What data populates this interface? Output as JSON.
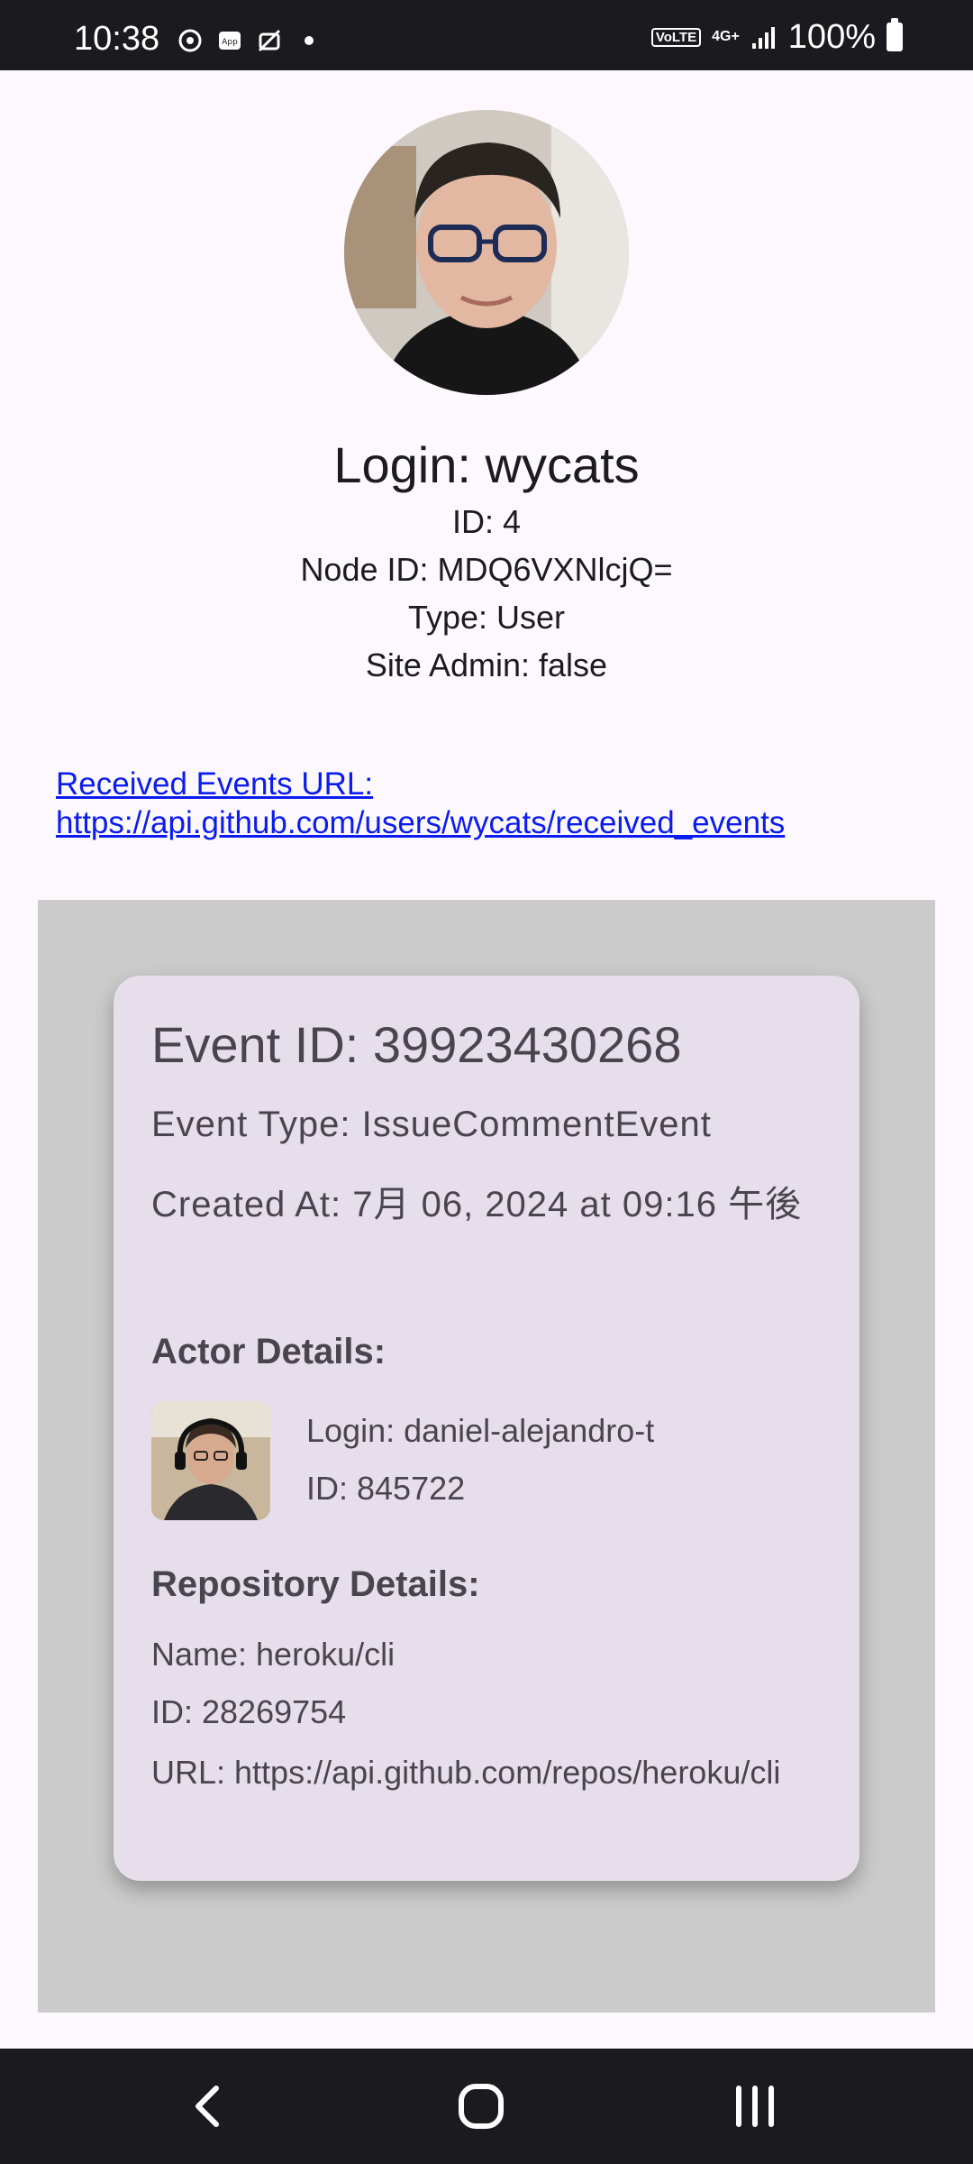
{
  "status_bar": {
    "time": "10:38",
    "volte": "VoLTE",
    "network": "4G+",
    "battery": "100%"
  },
  "profile": {
    "login": "Login: wycats",
    "id": "ID: 4",
    "node_id": "Node ID: MDQ6VXNlcjQ=",
    "type": "Type: User",
    "site_admin": "Site Admin: false",
    "received_events_link": "Received Events URL: https://api.github.com/users/wycats/received_events"
  },
  "event": {
    "event_id": "Event ID: 39923430268",
    "event_type": "Event Type: IssueCommentEvent",
    "created_at": "Created At: 7月 06, 2024 at 09:16 午後",
    "actor_heading": "Actor Details:",
    "actor_login": "Login: daniel-alejandro-t",
    "actor_id": "ID: 845722",
    "repo_heading": "Repository Details:",
    "repo_name": "Name: heroku/cli",
    "repo_id": "ID: 28269754",
    "repo_url": "URL: https://api.github.com/repos/heroku/cli"
  },
  "icons": {
    "nav_back": "chevron-left-icon",
    "nav_home": "home-icon",
    "nav_recents": "recents-icon"
  },
  "colors": {
    "link": "#0b1cf0",
    "card": "#e6dfeb",
    "events_background": "#cbcbcb",
    "system_bars": "#1b1a1f"
  }
}
